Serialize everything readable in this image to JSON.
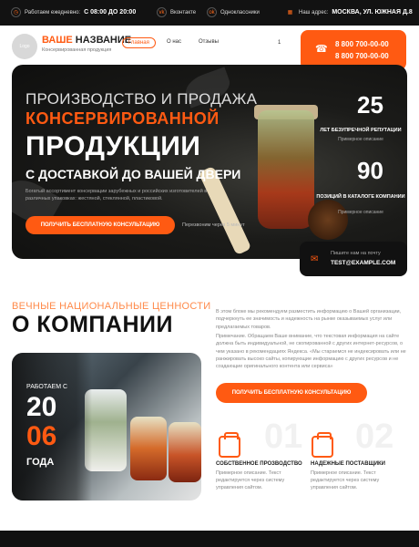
{
  "topbar": {
    "hours_label": "Работаем ежедневно:",
    "hours_value": "С 08:00 ДО 20:00",
    "social1": "Вконтакте",
    "social2": "Одноклассники",
    "address_label": "Наш адрес:",
    "address_value": "МОСКВА, УЛ. ЮЖНАЯ Д.8"
  },
  "header": {
    "logo_badge": "Logo",
    "logo_part1": "ВАШЕ",
    "logo_part2": "НАЗВАНИЕ",
    "logo_sub": "Консервированная продукция",
    "nav": [
      "Главная",
      "О нас",
      "Отзывы"
    ],
    "cart_count": "1",
    "phone1": "8 800 700-00-00",
    "phone2": "8 800 700-00-00"
  },
  "hero": {
    "line1": "ПРОИЗВОДСТВО И ПРОДАЖА",
    "line2": "КОНСЕРВИРОВАННОЙ",
    "line3": "ПРОДУКЦИИ",
    "line4": "С ДОСТАВКОЙ ДО ВАШЕЙ ДВЕРИ",
    "description": "Богатый ассортимент консервации зарубежных и российских изготовителей в различных упаковках: жестяной, стеклянной, пластиковой.",
    "button": "ПОЛУЧИТЬ БЕСПЛАТНУЮ КОНСУЛЬТАЦИЮ",
    "note": "Перезвоним через 5 минут",
    "stats": [
      {
        "value": "25",
        "label": "ЛЕТ БЕЗУПРЕЧНОЙ РЕПУТАЦИИ",
        "sub": "Примерное описание"
      },
      {
        "value": "90",
        "label": "ПОЗИЦИЙ В КАТАЛОГЕ КОМПАНИИ",
        "sub": "Примерное описание"
      }
    ],
    "email_label": "Пишите нам на почту",
    "email_value": "TEST@EXAMPLE.COM"
  },
  "about": {
    "kicker": "ВЕЧНЫЕ НАЦИОНАЛЬНЫЕ ЦЕННОСТИ",
    "title": "О КОМПАНИИ",
    "p1": "В этом блоке мы рекомендуем разместить информацию о Вашей организации, подчеркнуть ее значимость и надежность на рынке оказываемых услуг или предлагаемых товаров.",
    "p2": "Примечание. Обращаем Ваше внимание, что текстовая информация на сайте должна быть индивидуальной, не скопированной с других интернет-ресурсов, о чем указано в рекомендациях Яндекса. «Мы стараемся не индексировать или не ранжировать высоко сайты, копирующие информацию с других ресурсов и не создающие оригинального контента или сервиса»",
    "since": "РАБОТАЕМ С",
    "year1": "20",
    "year2": "06",
    "years_word": "ГОДА",
    "button": "ПОЛУЧИТЬ БЕСПЛАТНУЮ КОНСУЛЬТАЦИЮ",
    "features": [
      {
        "num": "01",
        "title": "СОБСТВЕННОЕ ПРОЗВОДСТВО",
        "desc": "Примерное описание. Текст редактируется через систему управления сайтом."
      },
      {
        "num": "02",
        "title": "НАДЕЖНЫЕ ПОСТАВЩИКИ",
        "desc": "Примерное описание. Текст редактируется через систему управления сайтом."
      }
    ]
  },
  "colors": {
    "accent": "#ff5a12",
    "dark": "#121212"
  }
}
